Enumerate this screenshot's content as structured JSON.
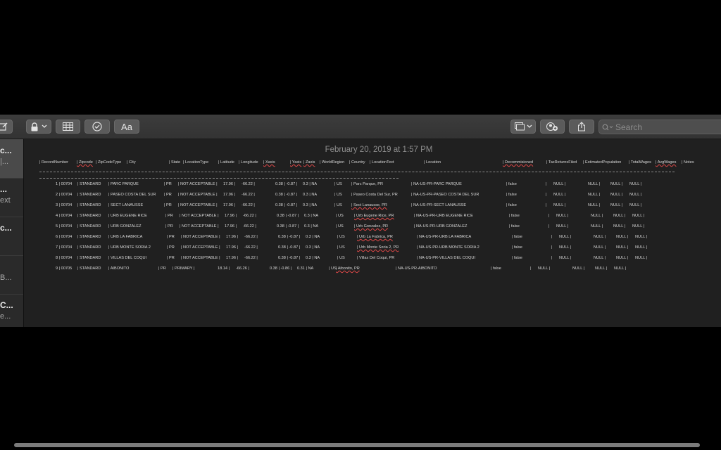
{
  "toolbar": {
    "format_label": "Aa",
    "search_placeholder": "Search"
  },
  "sidebar": {
    "items": [
      {
        "title": "c...",
        "subtitle": "|..."
      },
      {
        "title": "...",
        "subtitle": "ext"
      },
      {
        "title": "c...",
        "subtitle": ""
      },
      {
        "title": "",
        "subtitle": "B..."
      },
      {
        "title": "C...",
        "subtitle": "e..."
      }
    ]
  },
  "note": {
    "date": "February 20, 2019 at 1:57 PM",
    "headers": [
      "| RecordNumber",
      "| Zipcode",
      "| ZipCodeType",
      "| City",
      "| State",
      "| LocationType",
      "| Latitude",
      "| Longitude",
      "| Xaxis",
      "| Yaxis",
      "| Zaxis",
      "| WorldRegion",
      "| Country",
      "| LocationText",
      "| Location",
      "| Decommisioned",
      "| TaxReturnsFiled",
      "| EstimatedPopulation",
      "| TotalWages",
      "| AvgWages",
      "| Notes"
    ],
    "rows": [
      [
        "1 | 00704",
        "| STANDARD",
        "| PARC PARQUE",
        "| PR",
        "| NOT ACCEPTABLE |",
        "17.96 |",
        "-66.22 |",
        "0.38 | -0.87 |",
        "0.3 | NA",
        "| US",
        "| Parc Parque, PR",
        "| NA-US-PR-PARC PARQUE",
        "| false",
        "|",
        "NULL |",
        "NULL |",
        "NULL |",
        "NULL |"
      ],
      [
        "2 | 00704",
        "| STANDARD",
        "| PASEO COSTA DEL SUR",
        "| PR",
        "| NOT ACCEPTABLE |",
        "17.96 |",
        "-66.22 |",
        "0.38 | -0.87 |",
        "0.3 | NA",
        "| US",
        "| Paseo Costa Del Sur, PR",
        "| NA-US-PR-PASEO COSTA DEL SUR",
        "| false",
        "|",
        "NULL |",
        "NULL |",
        "NULL |",
        "NULL |"
      ],
      [
        "3 | 00704",
        "| STANDARD",
        "| SECT LANAUSSE",
        "| PR",
        "| NOT ACCEPTABLE |",
        "17.96 |",
        "-66.22 |",
        "0.38 | -0.87 |",
        "0.3 | NA",
        "| US",
        "| Sect Lanausse, PR",
        "| NA-US-PR-SECT LANAUSSE",
        "| false",
        "|",
        "NULL |",
        "NULL |",
        "NULL |",
        "NULL |"
      ],
      [
        "4 | 00704",
        "| STANDARD",
        "| URB EUGENE RICE",
        "| PR",
        "| NOT ACCEPTABLE |",
        "17.96 |",
        "-66.22 |",
        "0.38 | -0.87 |",
        "0.3 | NA",
        "| US",
        "| Urb Eugene Rice, PR",
        "| NA-US-PR-URB EUGENE RICE",
        "| false",
        "|",
        "NULL |",
        "NULL |",
        "NULL |",
        "NULL |"
      ],
      [
        "5 | 00704",
        "| STANDARD",
        "| URB GONZALEZ",
        "| PR",
        "| NOT ACCEPTABLE |",
        "17.96 |",
        "-66.22 |",
        "0.38 | -0.87 |",
        "0.3 | NA",
        "| US",
        "| Urb Gonzalez, PR",
        "| NA-US-PR-URB GONZALEZ",
        "| false",
        "|",
        "NULL |",
        "NULL |",
        "NULL |",
        "NULL |"
      ],
      [
        "6 | 00704",
        "| STANDARD",
        "| URB LA FABRICA",
        "| PR",
        "| NOT ACCEPTABLE |",
        "17.96 |",
        "-66.22 |",
        "0.38 | -0.87 |",
        "0.3 | NA",
        "| US",
        "| Urb La Fabrica, PR",
        "| NA-US-PR-URB LA FABRICA",
        "| false",
        "|",
        "NULL |",
        "NULL |",
        "NULL |",
        "NULL |"
      ],
      [
        "7 | 00704",
        "| STANDARD",
        "| URB MONTE SORIA 2",
        "| PR",
        "| NOT ACCEPTABLE |",
        "17.96 |",
        "-66.22 |",
        "0.38 | -0.87 |",
        "0.3 | NA",
        "| US",
        "| Urb Monte Soria 2, PR",
        "| NA-US-PR-URB MONTE SORIA 2",
        "| false",
        "|",
        "NULL |",
        "NULL |",
        "NULL |",
        "NULL |"
      ],
      [
        "8 | 00704",
        "| STANDARD",
        "| VILLAS DEL COQUI",
        "| PR",
        "| NOT ACCEPTABLE |",
        "17.96 |",
        "-66.22 |",
        "0.38 | -0.87 |",
        "0.3 | NA",
        "| US",
        "| Villas Del Coqui, PR",
        "| NA-US-PR-VILLAS DEL COQUI",
        "| false",
        "|",
        "NULL |",
        "NULL |",
        "NULL |",
        "NULL |"
      ],
      [
        "9 | 00705",
        "| STANDARD",
        "| AIBONITO",
        "| PR",
        "| PRIMARY |",
        "18.14 |",
        "-66.26 |",
        "0.38 | -0.86 |",
        "0.31 | NA",
        "| US",
        "| Aibonito, PR",
        "| NA-US-PR-AIBONITO",
        "| false",
        "|",
        "NULL |",
        "NULL |",
        "NULL |",
        "NULL |"
      ]
    ]
  },
  "icons": {
    "compose": "compose-icon",
    "lock": "lock-icon",
    "table": "table-icon",
    "checklist": "checklist-icon",
    "media": "media-icon",
    "collaborate": "add-people-icon",
    "share": "share-icon",
    "search": "search-icon"
  }
}
